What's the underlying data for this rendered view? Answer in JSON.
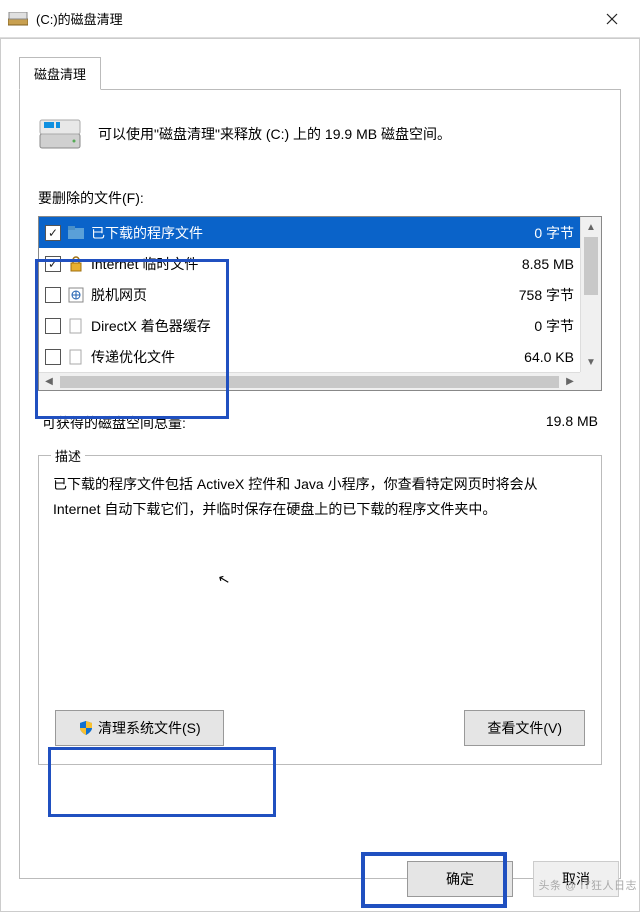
{
  "titlebar": {
    "title": "(C:)的磁盘清理"
  },
  "tab": {
    "label": "磁盘清理"
  },
  "intro": "可以使用\"磁盘清理\"来释放  (C:) 上的 19.9 MB 磁盘空间。",
  "files_label": "要删除的文件(F):",
  "file_list": [
    {
      "checked": true,
      "name": "已下载的程序文件",
      "size": "0 字节",
      "icon": "folder",
      "selected": true
    },
    {
      "checked": true,
      "name": "Internet 临时文件",
      "size": "8.85 MB",
      "icon": "lock",
      "selected": false
    },
    {
      "checked": false,
      "name": "脱机网页",
      "size": "758 字节",
      "icon": "page",
      "selected": false
    },
    {
      "checked": false,
      "name": "DirectX 着色器缓存",
      "size": "0 字节",
      "icon": "blank",
      "selected": false
    },
    {
      "checked": false,
      "name": "传递优化文件",
      "size": "64.0 KB",
      "icon": "blank",
      "selected": false
    }
  ],
  "total": {
    "label": "可获得的磁盘空间总量:",
    "value": "19.8 MB"
  },
  "description": {
    "legend": "描述",
    "text": "已下载的程序文件包括 ActiveX 控件和 Java 小程序，你查看特定网页时将会从 Internet 自动下载它们，并临时保存在硬盘上的已下载的程序文件夹中。",
    "clean_system_btn": "清理系统文件(S)",
    "view_files_btn": "查看文件(V)"
  },
  "dialog_buttons": {
    "ok": "确定",
    "cancel": "取消"
  },
  "watermark": "头条 @ IT狂人日志"
}
